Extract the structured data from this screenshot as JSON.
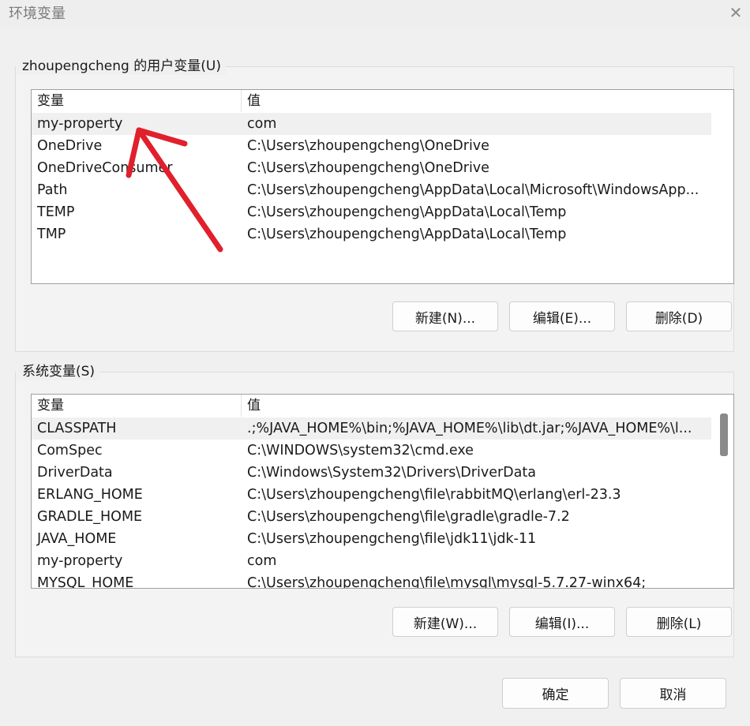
{
  "window": {
    "title": "环境变量",
    "close_glyph": "✕"
  },
  "user_vars": {
    "label": "zhoupengcheng 的用户变量(U)",
    "headers": {
      "name": "变量",
      "value": "值"
    },
    "rows": [
      {
        "name": "my-property",
        "value": "com"
      },
      {
        "name": "OneDrive",
        "value": "C:\\Users\\zhoupengcheng\\OneDrive"
      },
      {
        "name": "OneDriveConsumer",
        "value": "C:\\Users\\zhoupengcheng\\OneDrive"
      },
      {
        "name": "Path",
        "value": "C:\\Users\\zhoupengcheng\\AppData\\Local\\Microsoft\\WindowsApp..."
      },
      {
        "name": "TEMP",
        "value": "C:\\Users\\zhoupengcheng\\AppData\\Local\\Temp"
      },
      {
        "name": "TMP",
        "value": "C:\\Users\\zhoupengcheng\\AppData\\Local\\Temp"
      }
    ],
    "buttons": {
      "new": "新建(N)...",
      "edit": "编辑(E)...",
      "delete": "删除(D)"
    }
  },
  "system_vars": {
    "label": "系统变量(S)",
    "headers": {
      "name": "变量",
      "value": "值"
    },
    "rows": [
      {
        "name": "CLASSPATH",
        "value": ".;%JAVA_HOME%\\bin;%JAVA_HOME%\\lib\\dt.jar;%JAVA_HOME%\\l..."
      },
      {
        "name": "ComSpec",
        "value": "C:\\WINDOWS\\system32\\cmd.exe"
      },
      {
        "name": "DriverData",
        "value": "C:\\Windows\\System32\\Drivers\\DriverData"
      },
      {
        "name": "ERLANG_HOME",
        "value": "C:\\Users\\zhoupengcheng\\file\\rabbitMQ\\erlang\\erl-23.3"
      },
      {
        "name": "GRADLE_HOME",
        "value": "C:\\Users\\zhoupengcheng\\file\\gradle\\gradle-7.2"
      },
      {
        "name": "JAVA_HOME",
        "value": "C:\\Users\\zhoupengcheng\\file\\jdk11\\jdk-11"
      },
      {
        "name": "my-property",
        "value": "com"
      },
      {
        "name": "MYSQL_HOME",
        "value": "C:\\Users\\zhoupengcheng\\file\\mysql\\mysql-5.7.27-winx64;"
      }
    ],
    "buttons": {
      "new": "新建(W)...",
      "edit": "编辑(I)...",
      "delete": "删除(L)"
    }
  },
  "footer": {
    "ok": "确定",
    "cancel": "取消"
  },
  "colors": {
    "annotation_arrow": "#e0202c",
    "selected_row": "#f0f0f0"
  }
}
